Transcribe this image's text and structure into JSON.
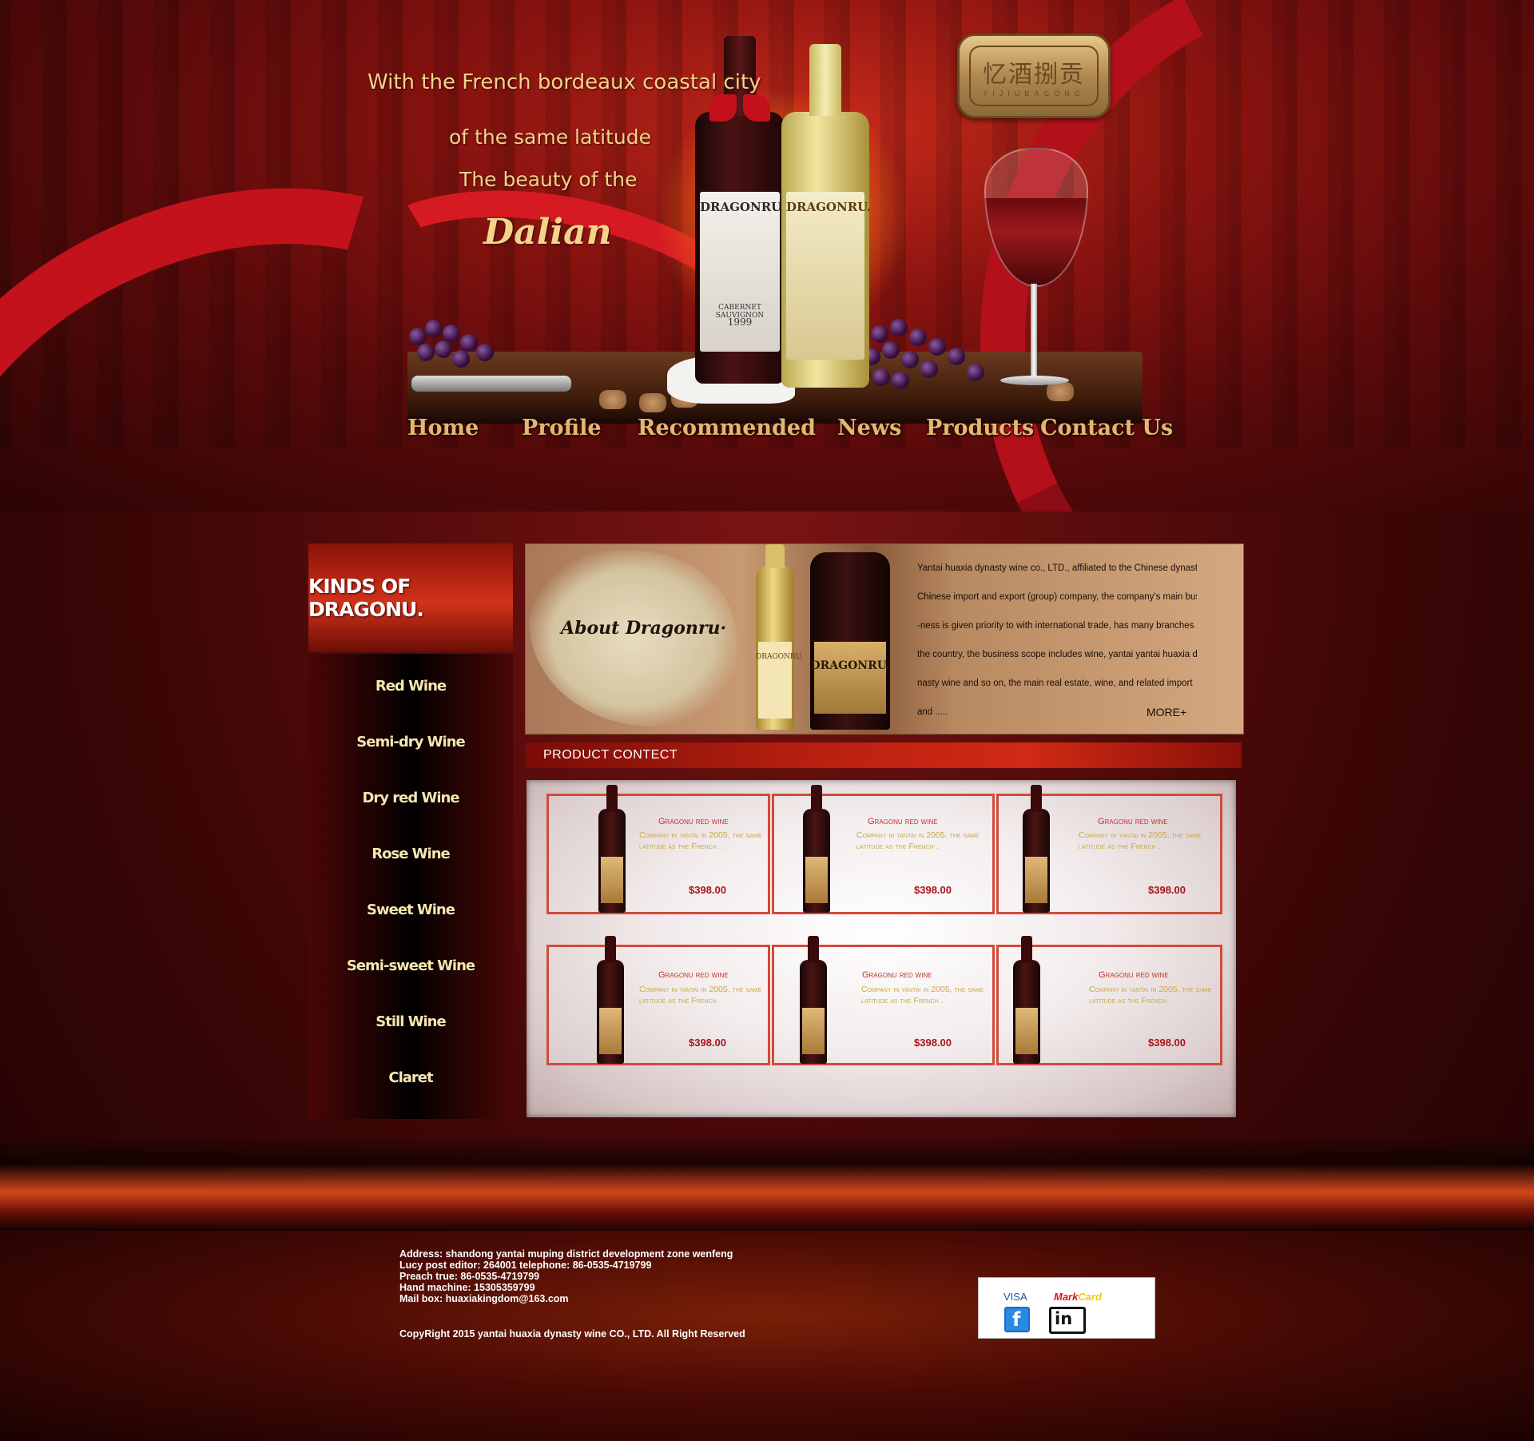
{
  "hero": {
    "line1": "With the French bordeaux coastal city",
    "line2": "of the same latitude",
    "line3": "The beauty of the",
    "line4": "Dalian",
    "bottle_brand": "DRAGONRU.",
    "red_label_1": "CABERNET SAUVIGNON",
    "red_label_2": "1999",
    "logo_text": "忆酒捌贡",
    "logo_sub": "YIJIUBAGONG"
  },
  "nav": {
    "items": [
      "Home",
      "Profile",
      "Recommended",
      "News",
      "Products",
      "Contact Us"
    ]
  },
  "sidebar": {
    "title": "KINDS OF DRAGONU.",
    "items": [
      "Red Wine",
      "Semi-dry Wine",
      "Dry red Wine",
      "Rose Wine",
      "Sweet Wine",
      "Semi-sweet Wine",
      "Still Wine",
      "Claret"
    ]
  },
  "about": {
    "title": "About  Dragonru·",
    "brand": "DRAGONRU.",
    "lines": [
      "Yantai huaxia dynasty wine co., LTD., affiliated to the Chinese dynasty",
      "Chinese import and export (group) company, the company's main busi",
      "-ness is given priority to with international trade, has many branches in",
      "the country, the business scope includes wine, yantai yantai huaxia dy",
      "nasty wine and so on, the main real estate, wine, and related import",
      "and ....."
    ],
    "more": "MORE+"
  },
  "products": {
    "header": "PRODUCT   CONTECT",
    "items": [
      {
        "name": "Gragonu red wine",
        "desc": "Company in yantai in 2005, the same latitude as the French .",
        "price": "$398.00"
      },
      {
        "name": "Gragonu red wine",
        "desc": "Company in yantai in 2005, the same latitude as the French .",
        "price": "$398.00"
      },
      {
        "name": "Gragonu red wine",
        "desc": "Company in yantai in 2005, the same latitude as the French .",
        "price": "$398.00"
      },
      {
        "name": "Gragonu red wine",
        "desc": "Company in yantai in 2005, the same latitude as the French .",
        "price": "$398.00"
      },
      {
        "name": "Gragonu red wine",
        "desc": "Company in yantai in 2005, the same latitude as the French .",
        "price": "$398.00"
      },
      {
        "name": "Gragonu red wine",
        "desc": "Company in yantai in 2005, the same latitude as the French .",
        "price": "$398.00"
      }
    ]
  },
  "footer": {
    "lines": [
      "Address: shandong yantai muping district development zone wenfeng",
      "Lucy post editor: 264001 telephone: 86-0535-4719799",
      "Preach true: 86-0535-4719799",
      "Hand machine: 15305359799",
      "Mail box: huaxiakingdom@163.com"
    ],
    "copyright": "CopyRight 2015 yantai huaxia dynasty wine CO., LTD. All Right Reserved",
    "visa": "VISA",
    "mark": "Mark",
    "card": "Card",
    "facebook_glyph": "f",
    "linkedin_glyph": "in"
  },
  "colors": {
    "accent_gold": "#f4d38a",
    "nav_gold": "#e0b870",
    "price_red": "#a8161a",
    "card_border": "#d24a3a"
  },
  "icons": [
    "facebook-icon",
    "linkedin-icon"
  ]
}
